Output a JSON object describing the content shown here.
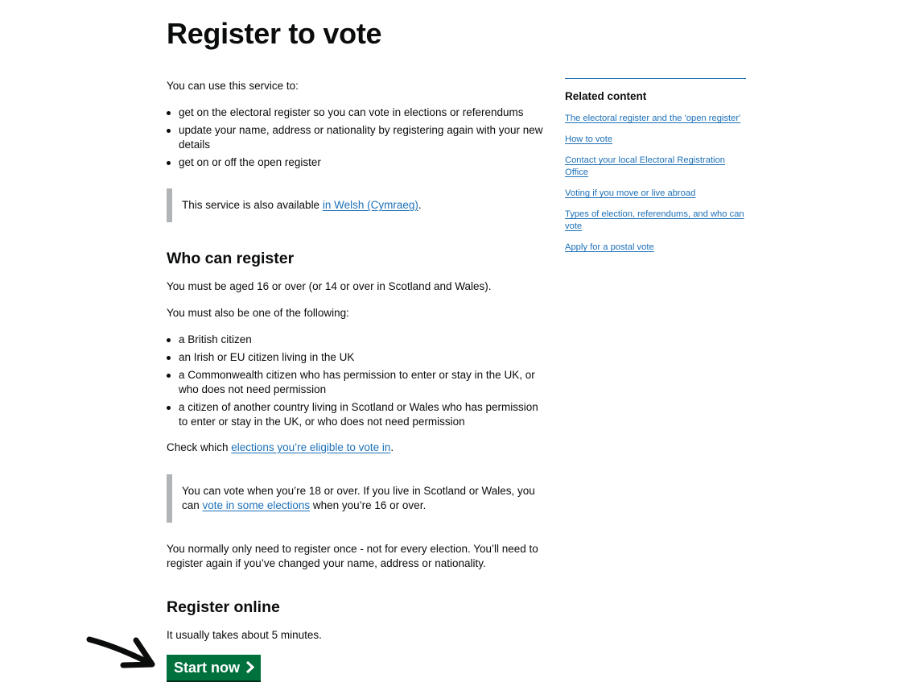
{
  "page": {
    "title": "Register to vote",
    "intro": "You can use this service to:",
    "uses": [
      "get on the electoral register so you can vote in elections or referendums",
      "update your name, address or nationality by registering again with your new details",
      "get on or off the open register"
    ],
    "welsh_notice": {
      "prefix": "This service is also available ",
      "link": "in Welsh (Cymraeg)",
      "suffix": "."
    },
    "who_heading": "Who can register",
    "age_text": "You must be aged 16 or over (or 14 or over in Scotland and Wales).",
    "also_text": "You must also be one of the following:",
    "eligibility": [
      "a British citizen",
      "an Irish or EU citizen living in the UK",
      "a Commonwealth citizen who has permission to enter or stay in the UK, or who does not need permission",
      "a citizen of another country living in Scotland or Wales who has permission to enter or stay in the UK, or who does not need permission"
    ],
    "check": {
      "prefix": "Check which ",
      "link": "elections you’re eligible to vote in",
      "suffix": "."
    },
    "vote_notice": {
      "prefix": "You can vote when you’re 18 or over. If you live in Scotland or Wales, you can ",
      "link": "vote in some elections",
      "suffix": " when you’re 16 or over."
    },
    "once_text": "You normally only need to register once - not for every election. You’ll need to register again if you’ve changed your name, address or nationality.",
    "online_heading": "Register online",
    "time_text": "It usually takes about 5 minutes.",
    "start_button": "Start now"
  },
  "sidebar": {
    "heading": "Related content",
    "links": [
      "The electoral register and the 'open register'",
      "How to vote",
      "Contact your local Electoral Registration Office",
      "Voting if you move or live abroad",
      "Types of election, referendums, and who can vote",
      "Apply for a postal vote"
    ]
  },
  "colors": {
    "link": "#1d70b8",
    "button": "#00703c",
    "inset_border": "#b1b4b6",
    "text": "#0b0c0c"
  }
}
